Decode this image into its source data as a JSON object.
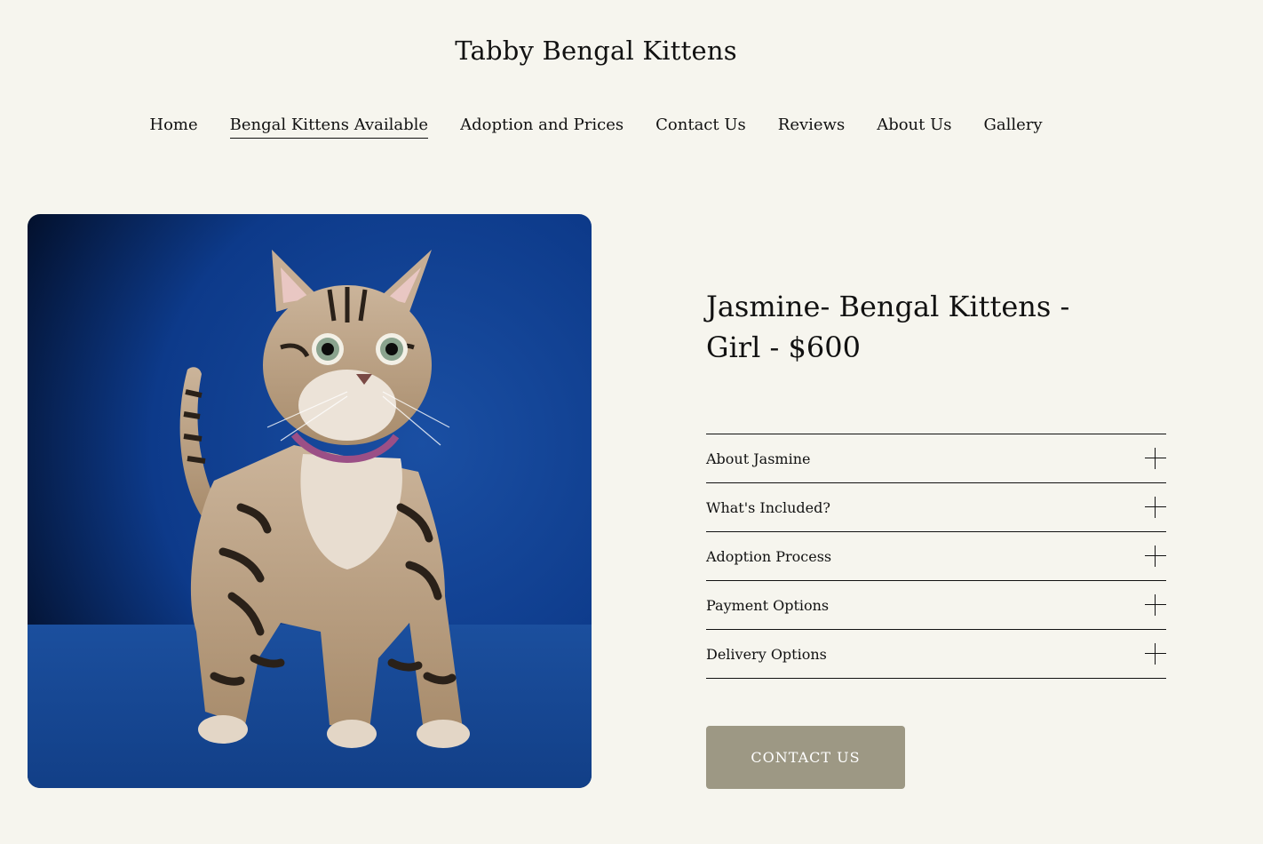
{
  "site": {
    "title": "Tabby Bengal Kittens"
  },
  "nav": {
    "items": [
      {
        "label": "Home"
      },
      {
        "label": "Bengal Kittens Available"
      },
      {
        "label": "Adoption and Prices"
      },
      {
        "label": "Contact Us"
      },
      {
        "label": "Reviews"
      },
      {
        "label": "About Us"
      },
      {
        "label": "Gallery"
      }
    ],
    "active": "Bengal Kittens Available"
  },
  "product": {
    "title": " Jasmine- Bengal Kittens - Girl - $600"
  },
  "accordion": {
    "items": [
      {
        "label": "About Jasmine",
        "icon": "plus-icon"
      },
      {
        "label": "What's Included?",
        "icon": "plus-icon"
      },
      {
        "label": "Adoption Process",
        "icon": "plus-icon"
      },
      {
        "label": "Payment Options",
        "icon": "plus-icon"
      },
      {
        "label": "Delivery Options",
        "icon": "plus-icon"
      }
    ]
  },
  "cta": {
    "label": "CONTACT US",
    "color": "#9d9884"
  },
  "colors": {
    "background": "#f6f5ee",
    "photo_backdrop": "#0d3a8a"
  }
}
